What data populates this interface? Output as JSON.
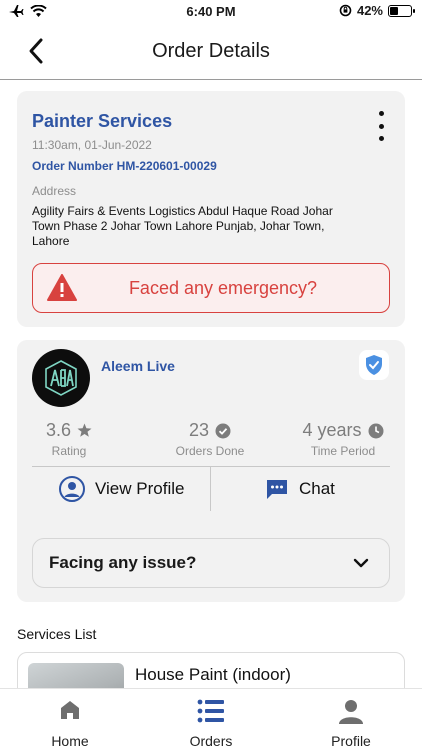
{
  "status_bar": {
    "time": "6:40 PM",
    "battery_percent": "42%",
    "battery_level": 0.42
  },
  "header": {
    "title": "Order Details",
    "back_icon": "back-arrow-icon"
  },
  "order": {
    "service_title": "Painter Services",
    "date": "11:30am, 01-Jun-2022",
    "order_number": "Order Number HM-220601-00029",
    "address_label": "Address",
    "address": "Agility Fairs & Events Logistics Abdul Haque Road Johar Town Phase 2 Johar Town Lahore Punjab, Johar Town, Lahore",
    "emergency_label": "Faced any emergency?",
    "emergency_color": "#d8423f"
  },
  "provider": {
    "name": "Aleem Live",
    "rating_value": "3.6",
    "rating_label": "Rating",
    "orders_value": "23",
    "orders_label": "Orders Done",
    "time_value": "4 years",
    "time_label": "Time Period",
    "view_profile_label": "View Profile",
    "chat_label": "Chat",
    "issue_label": "Facing any issue?"
  },
  "services": {
    "heading": "Services List",
    "items": [
      {
        "name": "House Paint (indoor)"
      }
    ]
  },
  "nav": {
    "items": [
      {
        "label": "Home",
        "icon": "home-icon"
      },
      {
        "label": "Orders",
        "icon": "list-icon"
      },
      {
        "label": "Profile",
        "icon": "person-icon"
      }
    ],
    "active_color": "#2f55a4"
  },
  "colors": {
    "brand_blue": "#2f55a4",
    "card_bg": "#f2f2f2"
  }
}
